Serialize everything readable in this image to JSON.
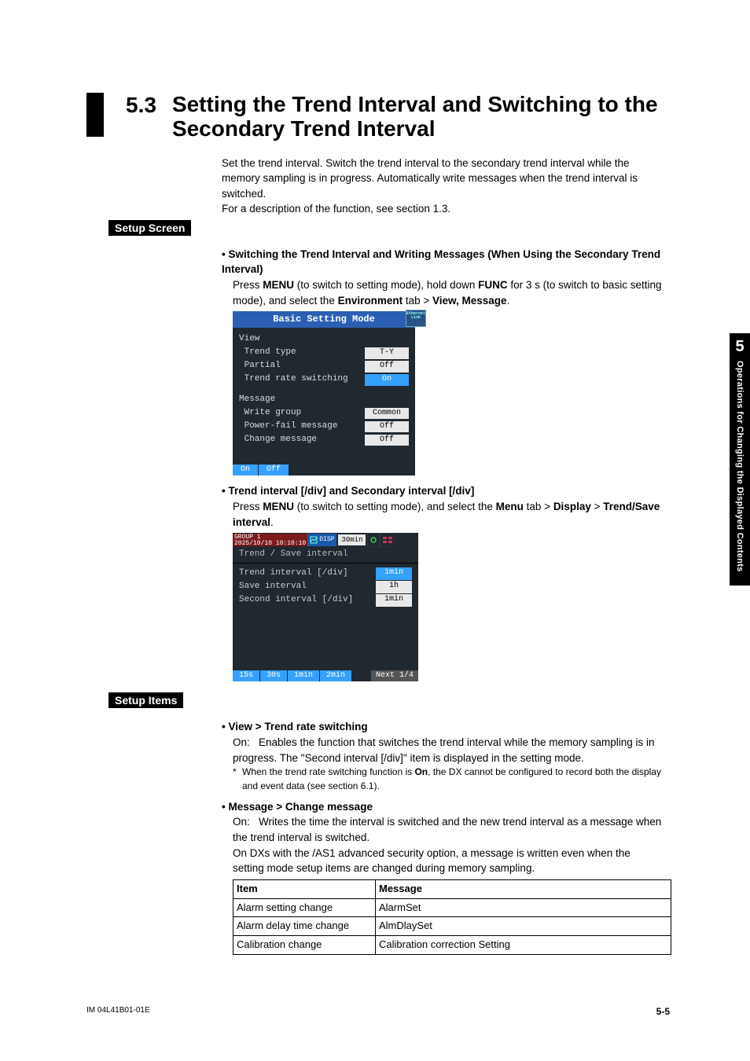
{
  "heading": {
    "number": "5.3",
    "title": "Setting the Trend Interval and Switching to the Secondary Trend Interval"
  },
  "intro": {
    "p1": "Set the trend interval. Switch the trend interval to the secondary trend interval while the memory sampling is in progress. Automatically write messages when the trend interval is switched.",
    "p2": "For a description of the function, see section 1.3."
  },
  "sections": {
    "setup_screen": "Setup Screen",
    "setup_items": "Setup Items"
  },
  "bullets": {
    "b1_title": "Switching the Trend Interval and Writing Messages (When Using the Secondary Trend Interval)",
    "b1_line_pre": "Press ",
    "b1_menu": "MENU",
    "b1_line_mid1": " (to switch to setting mode), hold down ",
    "b1_func": "FUNC",
    "b1_line_mid2": " for 3 s (to switch to basic setting mode), and select the ",
    "b1_env": "Environment",
    "b1_line_mid3": " tab > ",
    "b1_viewmsg": "View, Message",
    "b1_line_end": ".",
    "b2_title": "Trend interval [/div] and Secondary interval [/div]",
    "b2_line_pre": "Press ",
    "b2_menu": "MENU",
    "b2_mid1": " (to switch to setting mode), and select the ",
    "b2_menu2": "Menu",
    "b2_mid2": " tab > ",
    "b2_display": "Display",
    "b2_mid3": " > ",
    "b2_trendsave": "Trend/Save interval",
    "b2_end": ".",
    "b3_title": "View > Trend rate switching",
    "b3_p1": "On:   Enables the function that switches the trend interval while the memory sampling is in progress. The \"Second interval [/div]\" item is displayed in the setting mode.",
    "b3_f_pre": "When the trend rate switching function is ",
    "b3_f_on": "On",
    "b3_f_post": ", the DX cannot be configured to record both the display and event data (see section 6.1).",
    "b4_title": "Message > Change message",
    "b4_p1": "On:   Writes the time the interval is switched and the new trend interval as a message when the trend interval is switched.",
    "b4_p2": "On DXs with the /AS1 advanced security option, a message is written even when the setting mode setup items are changed during memory sampling."
  },
  "table": {
    "h1": "Item",
    "h2": "Message",
    "rows": [
      [
        "Alarm setting change",
        "AlarmSet"
      ],
      [
        "Alarm delay time change",
        "AlmDlaySet"
      ],
      [
        "Calibration change",
        "Calibration correction Setting"
      ]
    ]
  },
  "scr1": {
    "title": "Basic Setting Mode",
    "eth": "Ethernet\nLink",
    "view_hdr": "View",
    "items1": [
      {
        "lbl": " Trend type",
        "val": "T-Y"
      },
      {
        "lbl": " Partial",
        "val": "Off"
      },
      {
        "lbl": " Trend rate switching",
        "val": "On",
        "hl": true
      }
    ],
    "msg_hdr": "Message",
    "items2": [
      {
        "lbl": " Write group",
        "val": "Common"
      },
      {
        "lbl": " Power-fail message",
        "val": "Off"
      },
      {
        "lbl": " Change message",
        "val": "Off"
      }
    ],
    "foot": [
      "On",
      "Off"
    ]
  },
  "scr2": {
    "group": "GROUP 1",
    "datetime": "2025/10/10 10:10:10",
    "disp": "DISP",
    "rate": "30min",
    "subtitle": "Trend / Save interval",
    "items": [
      {
        "lbl": "Trend interval [/div]",
        "val": "1min",
        "hl": true
      },
      {
        "lbl": "Save interval",
        "val": "1h"
      },
      {
        "lbl": "Second interval [/div]",
        "val": "1min"
      }
    ],
    "foot": [
      "15s",
      "30s",
      "1min",
      "2min"
    ],
    "next": "Next 1/4"
  },
  "tab": {
    "num": "5",
    "text": "Operations for Changing the Displayed Contents"
  },
  "footer": {
    "left": "IM 04L41B01-01E",
    "right": "5-5"
  }
}
